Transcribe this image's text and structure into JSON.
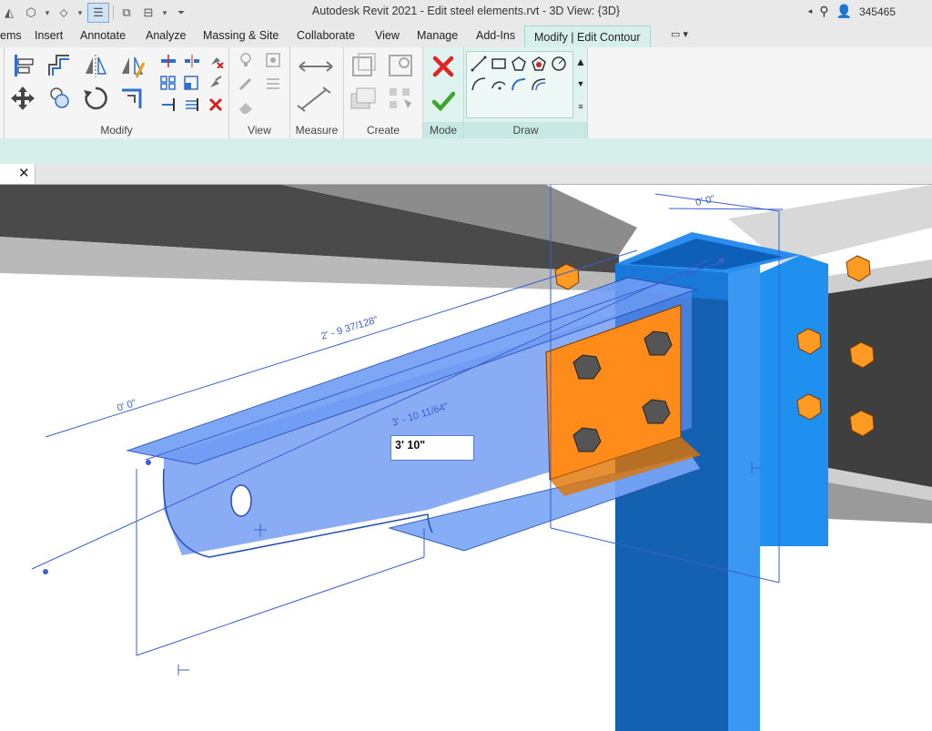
{
  "app": {
    "title": "Autodesk Revit 2021 - Edit steel elements.rvt - 3D View: {3D}",
    "user": "345465"
  },
  "ribbon_tabs": [
    {
      "label": "ems"
    },
    {
      "label": "Insert"
    },
    {
      "label": "Annotate"
    },
    {
      "label": "Analyze"
    },
    {
      "label": "Massing & Site"
    },
    {
      "label": "Collaborate"
    },
    {
      "label": "View"
    },
    {
      "label": "Manage"
    },
    {
      "label": "Add-Ins"
    },
    {
      "label": "Modify | Edit Contour",
      "active": true
    }
  ],
  "panels": {
    "modify": "Modify",
    "view": "View",
    "measure": "Measure",
    "create": "Create",
    "mode": "Mode",
    "draw": "Draw"
  },
  "view_tab": {
    "close": "✕"
  },
  "dimensions": {
    "top": "0' 0\"",
    "left": "0' 0\"",
    "diagonal_long": "2' - 9 37/128\"",
    "diagonal_mid": "3' - 10 11/64\""
  },
  "edit_field": {
    "value": "3'  10\""
  },
  "colors": {
    "accent_context_tab": "#d7f0ec",
    "selection_blue": "#5b8cf0",
    "plate_orange": "#ff8c1a",
    "column_blue": "#1f8ff0",
    "beam_gray": "#4d4d4d"
  },
  "icons": {
    "cancel": "cancel-edit-icon",
    "finish": "finish-edit-icon"
  }
}
